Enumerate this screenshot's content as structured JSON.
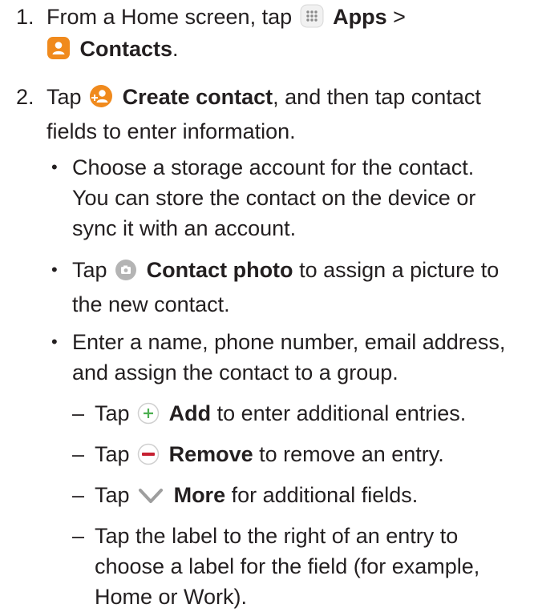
{
  "steps": [
    {
      "number": "1.",
      "pre": "From a Home screen, tap",
      "apps_label": "Apps",
      "separator": ">",
      "contacts_label": "Contacts",
      "end": "."
    },
    {
      "number": "2.",
      "pre": "Tap",
      "create_label": "Create contact",
      "rest_line1": ", and then tap contact",
      "rest_line2": "fields to enter information."
    }
  ],
  "bullets": [
    {
      "marker": "•",
      "line1": "Choose a storage account for the contact.",
      "line2": "You can store the contact on the device or",
      "line3": "sync it with an account."
    },
    {
      "marker": "•",
      "pre": "Tap",
      "label": "Contact photo",
      "rest_line1": "to assign a picture to",
      "line2": "the new contact."
    },
    {
      "marker": "•",
      "line1": "Enter a name, phone number, email address,",
      "line2": "and assign the contact to a group."
    }
  ],
  "subitems": [
    {
      "marker": "–",
      "pre": "Tap",
      "label": "Add",
      "rest": "to enter additional entries."
    },
    {
      "marker": "–",
      "pre": "Tap",
      "label": "Remove",
      "rest": "to remove an entry."
    },
    {
      "marker": "–",
      "pre": "Tap",
      "label": "More",
      "rest": "for additional fields."
    },
    {
      "marker": "–",
      "line1": "Tap the label to the right of an entry to",
      "line2": "choose a label for the field (for example,",
      "line3": "Home or Work)."
    }
  ],
  "icons": {
    "apps": "apps-grid-icon",
    "contacts": "contacts-app-icon",
    "create_contact": "create-contact-icon",
    "contact_photo": "camera-icon",
    "add": "plus-circle-icon",
    "remove": "minus-circle-icon",
    "more": "chevron-down-icon",
    "colors": {
      "orange": "#f08a1d",
      "green": "#4caf50",
      "red": "#c62032",
      "gray": "#9e9e9e"
    }
  }
}
